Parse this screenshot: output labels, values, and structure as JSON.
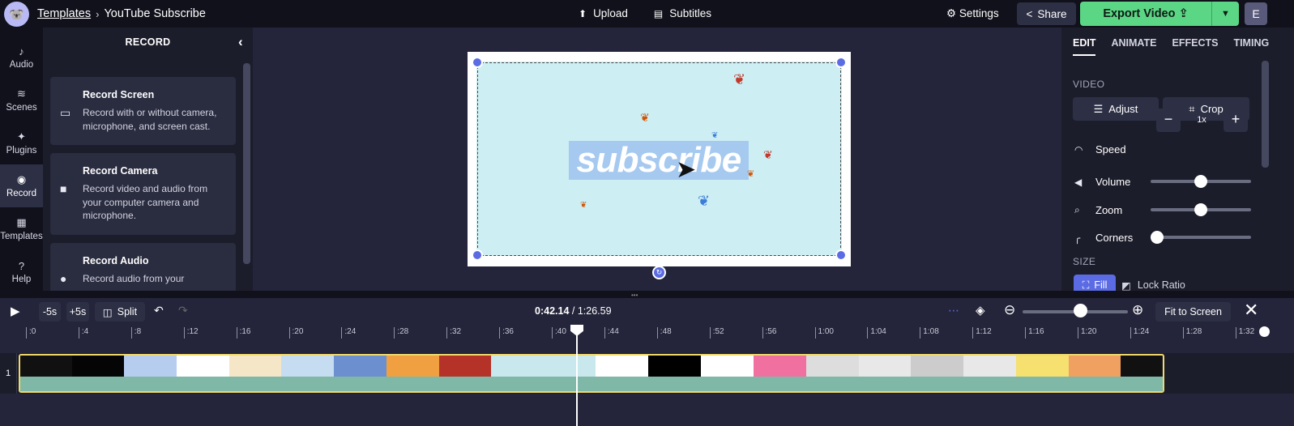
{
  "header": {
    "breadcrumb_link": "Templates",
    "breadcrumb_sep": "›",
    "project_title": "YouTube Subscribe",
    "upload": "Upload",
    "subtitles": "Subtitles",
    "settings": "Settings",
    "share": "Share",
    "export": "Export Video",
    "user_initial": "E"
  },
  "nav": [
    {
      "label": "Audio",
      "icon": "music-note-icon"
    },
    {
      "label": "Scenes",
      "icon": "layers-icon"
    },
    {
      "label": "Plugins",
      "icon": "plugin-icon"
    },
    {
      "label": "Record",
      "icon": "record-icon"
    },
    {
      "label": "Templates",
      "icon": "templates-icon"
    },
    {
      "label": "Help",
      "icon": "help-icon"
    }
  ],
  "record_panel": {
    "title": "RECORD",
    "cards": [
      {
        "title": "Record Screen",
        "desc": "Record with or without camera, microphone, and screen cast."
      },
      {
        "title": "Record Camera",
        "desc": "Record video and audio from your computer camera and microphone."
      },
      {
        "title": "Record Audio",
        "desc": "Record audio from your"
      }
    ]
  },
  "canvas": {
    "text": "subscribe",
    "bg_color": "#cdeef3",
    "highlight_color": "#a6c9f0",
    "handle_color": "#5b6be3"
  },
  "right_panel": {
    "tabs": [
      "EDIT",
      "ANIMATE",
      "EFFECTS",
      "TIMING"
    ],
    "video_section": "VIDEO",
    "adjust": "Adjust",
    "crop": "Crop",
    "speed_label": "Speed",
    "speed_value": "1x",
    "volume_label": "Volume",
    "volume_level": 0.5,
    "zoom_label": "Zoom",
    "zoom_level": 0.5,
    "corners_label": "Corners",
    "corners_level": 0.0,
    "size_section": "SIZE",
    "fill": "Fill",
    "lock_ratio": "Lock Ratio"
  },
  "timeline": {
    "minus5": "-5s",
    "plus5": "+5s",
    "split": "Split",
    "current_time": "0:42.14",
    "total_time": " / 1:26.59",
    "fit_to_screen": "Fit to Screen",
    "track_number": "1",
    "ticks": [
      ":0",
      ":4",
      ":8",
      ":12",
      ":16",
      ":20",
      ":24",
      ":28",
      ":32",
      ":36",
      ":40",
      ":44",
      ":48",
      ":52",
      ":56",
      "1:00",
      "1:04",
      "1:08",
      "1:12",
      "1:16",
      "1:20",
      "1:24",
      "1:28",
      "1:32"
    ],
    "clip_border_color": "#f0d86a",
    "accent_color": "#5bd685"
  }
}
